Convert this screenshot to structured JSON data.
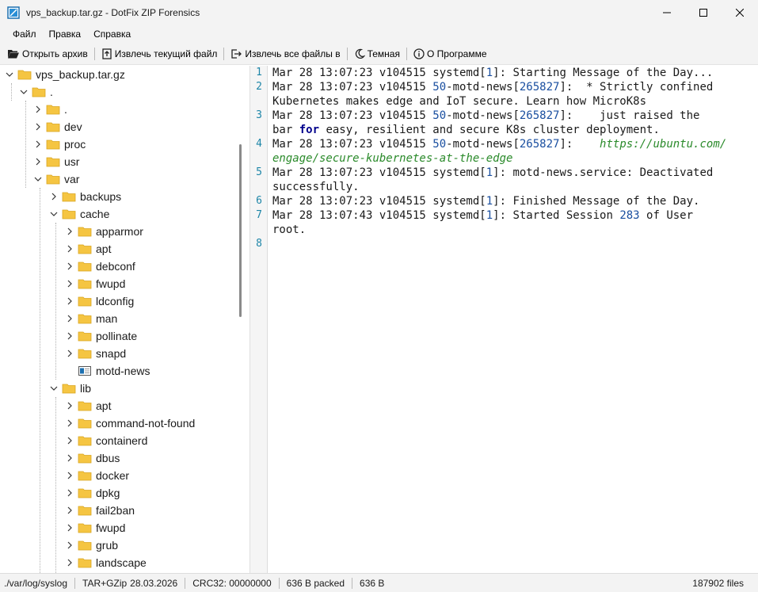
{
  "window": {
    "title": "vps_backup.tar.gz - DotFix ZIP Forensics",
    "icon": "zip-forensics-app-icon"
  },
  "menu": [
    {
      "id": "file",
      "label": "Файл"
    },
    {
      "id": "edit",
      "label": "Правка"
    },
    {
      "id": "help",
      "label": "Справка"
    }
  ],
  "toolbar": {
    "open": "Открыть архив",
    "extract_current": "Извлечь текущий файл",
    "extract_all": "Извлечь все файлы в",
    "theme": "Темная",
    "about": "О Программе"
  },
  "tree": {
    "root": "vps_backup.tar.gz",
    "dot": ".",
    "dotdot": ".",
    "dev": "dev",
    "proc": "proc",
    "usr": "usr",
    "var": "var",
    "backups": "backups",
    "cache": "cache",
    "cache_items": [
      "apparmor",
      "apt",
      "debconf",
      "fwupd",
      "ldconfig",
      "man",
      "pollinate",
      "snapd"
    ],
    "motd_news": "motd-news",
    "lib": "lib",
    "lib_items": [
      "apt",
      "command-not-found",
      "containerd",
      "dbus",
      "docker",
      "dpkg",
      "fail2ban",
      "fwupd",
      "grub",
      "landscape"
    ]
  },
  "editor": {
    "line_numbers": [
      "1",
      "2",
      "3",
      "4",
      "5",
      "6",
      "7",
      "8"
    ],
    "lines": [
      "Mar 28 13:07:23 v104515 systemd[1]: Starting Message of the Day...",
      "Mar 28 13:07:23 v104515 50-motd-news[265827]:  * Strictly confined",
      "Kubernetes makes edge and IoT secure. Learn how MicroK8s",
      "Mar 28 13:07:23 v104515 50-motd-news[265827]:    just raised the",
      "bar for easy, resilient and secure K8s cluster deployment.",
      "Mar 28 13:07:23 v104515 50-motd-news[265827]:    https://ubuntu.com/",
      "engage/secure-kubernetes-at-the-edge",
      "Mar 28 13:07:23 v104515 systemd[1]: motd-news.service: Deactivated",
      "successfully.",
      "Mar 28 13:07:23 v104515 systemd[1]: Finished Message of the Day.",
      "Mar 28 13:07:43 v104515 systemd[1]: Started Session 283 of User",
      "root."
    ]
  },
  "status": {
    "path": "./var/log/syslog",
    "format": "TAR+GZip",
    "date": "28.03.2026",
    "crc": "CRC32: 00000000",
    "packed": "636 B packed",
    "size": "636 B",
    "files": "187902 files"
  },
  "colors": {
    "folder": "#f5c542",
    "line_number": "#1e86a8",
    "keyword": "#00008b",
    "url": "#2a8a2a",
    "number": "#1a4fa0"
  }
}
